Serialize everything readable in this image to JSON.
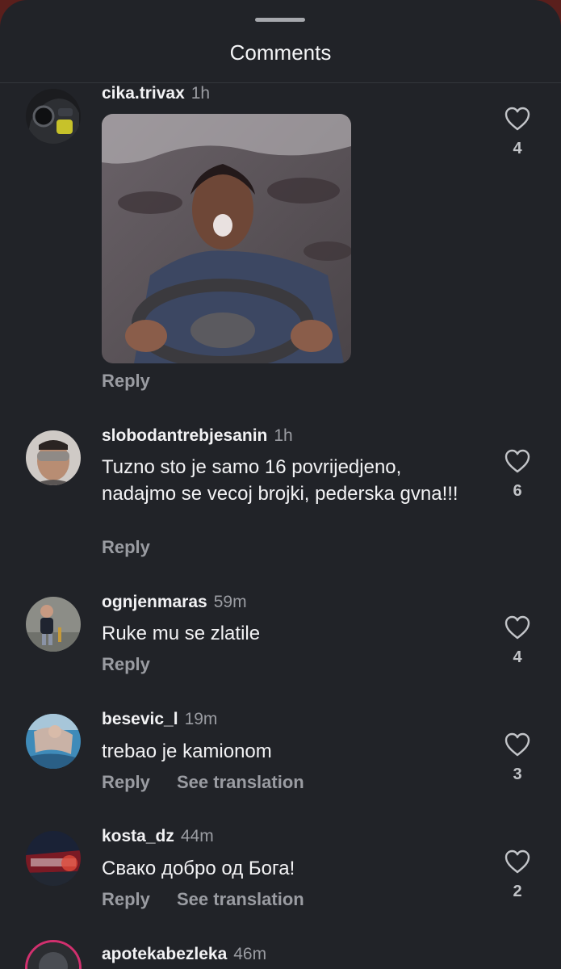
{
  "sheet": {
    "title": "Comments"
  },
  "comments": [
    {
      "username": "cika.trivax",
      "time": "1h",
      "text": "",
      "reply_label": "Reply",
      "likes": "4"
    },
    {
      "username": "slobodantrebjesanin",
      "time": "1h",
      "text": "Tuzno sto je samo 16 povrijedjeno, nadajmo se vecoj brojki, pederska gvna!!!",
      "reply_label": "Reply",
      "likes": "6"
    },
    {
      "username": "ognjenmaras",
      "time": "59m",
      "text": "Ruke mu se zlatile",
      "reply_label": "Reply",
      "likes": "4"
    },
    {
      "username": "besevic_l",
      "time": "19m",
      "text": "trebao je kamionom",
      "reply_label": "Reply",
      "translate_label": "See translation",
      "likes": "3"
    },
    {
      "username": "kosta_dz",
      "time": "44m",
      "text": "Свако добро од Бога!",
      "reply_label": "Reply",
      "translate_label": "See translation",
      "likes": "2"
    },
    {
      "username": "apotekabezleka",
      "time": "46m"
    }
  ],
  "icons": {
    "like": "heart-outline-icon"
  },
  "colors": {
    "background": "#212328",
    "text": "#f2f2f4",
    "muted": "#9a9ca2"
  }
}
